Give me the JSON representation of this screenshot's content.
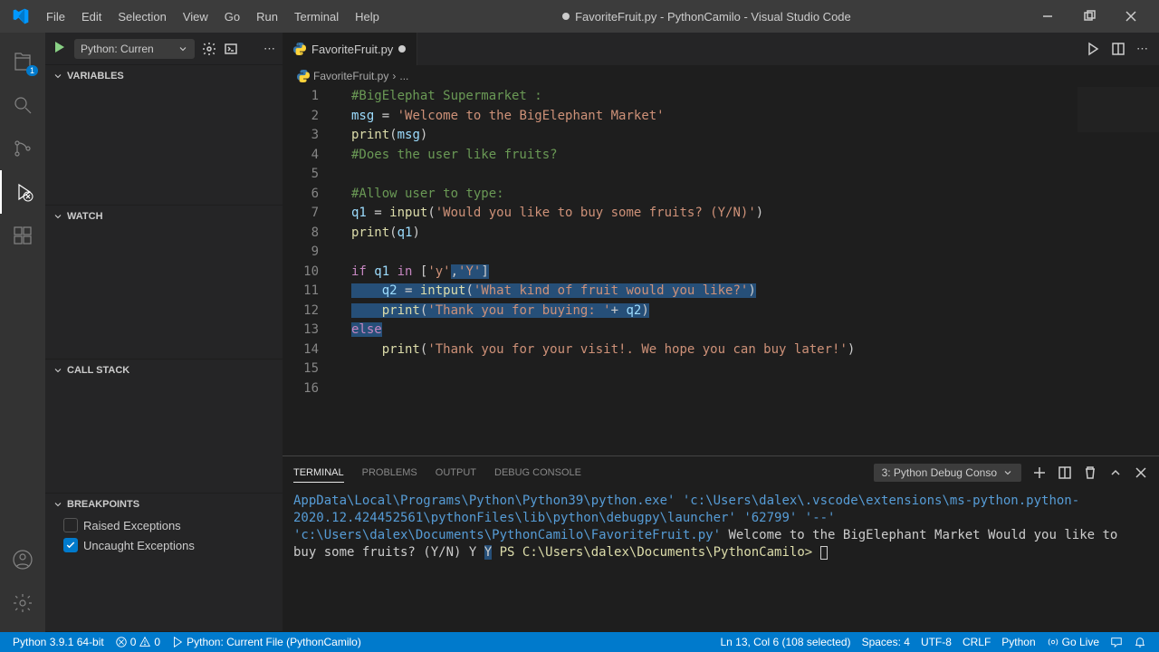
{
  "title": "FavoriteFruit.py - PythonCamilo - Visual Studio Code",
  "menu": [
    "File",
    "Edit",
    "Selection",
    "View",
    "Go",
    "Run",
    "Terminal",
    "Help"
  ],
  "activity_badge": "1",
  "debug": {
    "config": "Python: Curren",
    "sections": {
      "variables": "VARIABLES",
      "watch": "WATCH",
      "callstack": "CALL STACK",
      "breakpoints": "BREAKPOINTS"
    },
    "breakpoints": [
      {
        "label": "Raised Exceptions",
        "checked": false
      },
      {
        "label": "Uncaught Exceptions",
        "checked": true
      }
    ]
  },
  "tab": {
    "label": "FavoriteFruit.py",
    "modified": true
  },
  "breadcrumb": [
    "FavoriteFruit.py",
    "..."
  ],
  "code": {
    "lines": [
      "1",
      "2",
      "3",
      "4",
      "5",
      "6",
      "7",
      "8",
      "9",
      "10",
      "11",
      "12",
      "13",
      "14",
      "15",
      "16"
    ]
  },
  "terminal": {
    "tabs": [
      "TERMINAL",
      "PROBLEMS",
      "OUTPUT",
      "DEBUG CONSOLE"
    ],
    "active_tab": 0,
    "dropdown": "3: Python Debug Conso",
    "line1a": "AppData\\Local\\Programs\\Python\\Python39\\python.exe'",
    "line1b": "'c:\\Users\\dalex\\.vscode\\extensions\\ms-python.python-2020.12.424452561\\pythonFiles\\lib\\python\\debugpy\\launcher'",
    "line1c": "'62799'",
    "line1d": "'--'",
    "line1e": "'c:\\Users\\dalex\\Documents\\PythonCamilo\\FavoriteFruit.py'",
    "line2": "Welcome to the BigElephant Market",
    "line3": "Would you like to buy some fruits? (Y/N) Y",
    "line4": "Y",
    "prompt": "PS C:\\Users\\dalex\\Documents\\PythonCamilo>"
  },
  "status": {
    "python": "Python 3.9.1 64-bit",
    "errors": "0",
    "warnings": "0",
    "debug": "Python: Current File (PythonCamilo)",
    "position": "Ln 13, Col 6 (108 selected)",
    "spaces": "Spaces: 4",
    "encoding": "UTF-8",
    "eol": "CRLF",
    "lang": "Python",
    "golive": "Go Live"
  }
}
